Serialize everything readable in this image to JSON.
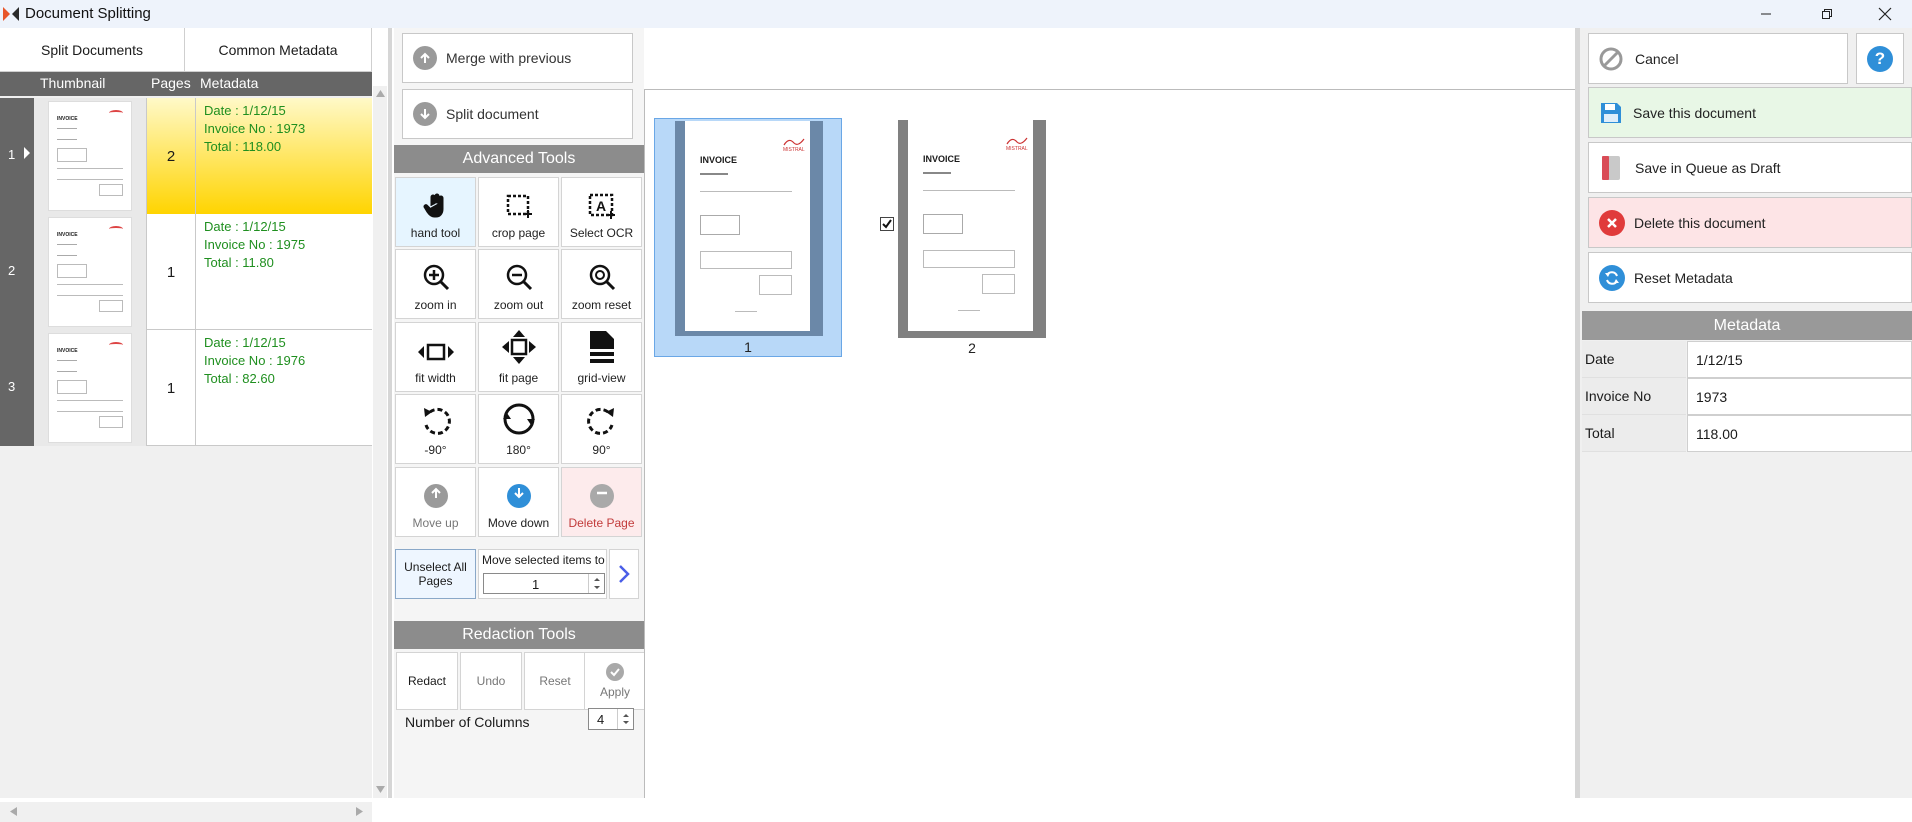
{
  "window": {
    "title": "Document Splitting"
  },
  "left_tabs": [
    "Split Documents",
    "Common Metadata"
  ],
  "grid_headers": {
    "thumbnail": "Thumbnail",
    "pages": "Pages",
    "metadata": "Metadata"
  },
  "documents": [
    {
      "index": "1",
      "pages": "2",
      "date": "Date : 1/12/15",
      "invoice": "Invoice No : 1973",
      "total": "Total : 118.00",
      "selected": true
    },
    {
      "index": "2",
      "pages": "1",
      "date": "Date : 1/12/15",
      "invoice": "Invoice No : 1975",
      "total": "Total : 11.80",
      "selected": false
    },
    {
      "index": "3",
      "pages": "1",
      "date": "Date : 1/12/15",
      "invoice": "Invoice No : 1976",
      "total": "Total : 82.60",
      "selected": false
    }
  ],
  "toolbar": {
    "merge_label": "Merge with previous",
    "split_label": "Split document"
  },
  "advanced_tools": {
    "header": "Advanced Tools",
    "tools": [
      {
        "label": "hand tool",
        "icon": "hand-icon"
      },
      {
        "label": "crop page",
        "icon": "crop-icon"
      },
      {
        "label": "Select OCR",
        "icon": "ocr-select-icon"
      },
      {
        "label": "zoom in",
        "icon": "zoom-in-icon"
      },
      {
        "label": "zoom out",
        "icon": "zoom-out-icon"
      },
      {
        "label": "zoom reset",
        "icon": "zoom-reset-icon"
      },
      {
        "label": "fit width",
        "icon": "fit-width-icon"
      },
      {
        "label": "fit page",
        "icon": "fit-page-icon"
      },
      {
        "label": "grid-view",
        "icon": "grid-view-icon"
      },
      {
        "label": "-90°",
        "icon": "rotate-left-icon"
      },
      {
        "label": "180°",
        "icon": "rotate-180-icon"
      },
      {
        "label": "90°",
        "icon": "rotate-right-icon"
      },
      {
        "label": "Move up",
        "icon": "arrow-up-icon"
      },
      {
        "label": "Move down",
        "icon": "arrow-down-icon"
      },
      {
        "label": "Delete Page",
        "icon": "minus-circle-icon"
      }
    ],
    "unselect_label": "Unselect All Pages",
    "move_to_label": "Move selected items to",
    "move_to_value": "1"
  },
  "redaction_tools": {
    "header": "Redaction Tools",
    "buttons": [
      "Redact",
      "Undo",
      "Reset",
      "Apply"
    ]
  },
  "columns": {
    "label": "Number of Columns",
    "value": "4"
  },
  "viewer": {
    "pages": [
      {
        "label": "1",
        "checked": true,
        "selected": true
      },
      {
        "label": "2",
        "checked": true,
        "selected": false
      }
    ],
    "thumb_heading": "INVOICE",
    "thumb_brand": "MISTRAL"
  },
  "actions": {
    "cancel": "Cancel",
    "help": "?",
    "save": "Save this document",
    "draft": "Save in Queue as Draft",
    "delete": "Delete this document",
    "reset": "Reset Metadata"
  },
  "metadata": {
    "header": "Metadata",
    "fields": [
      {
        "label": "Date",
        "value": "1/12/15"
      },
      {
        "label": "Invoice No",
        "value": "1973"
      },
      {
        "label": "Total",
        "value": "118.00"
      }
    ]
  },
  "colors": {
    "accent": "#2f8fd8",
    "selected_row": "#ffd400",
    "metadata_text": "#1f8f1f",
    "save_bg": "#e8f7e6",
    "delete_bg": "#fde4e6",
    "delete_icon": "#e03b3b"
  }
}
